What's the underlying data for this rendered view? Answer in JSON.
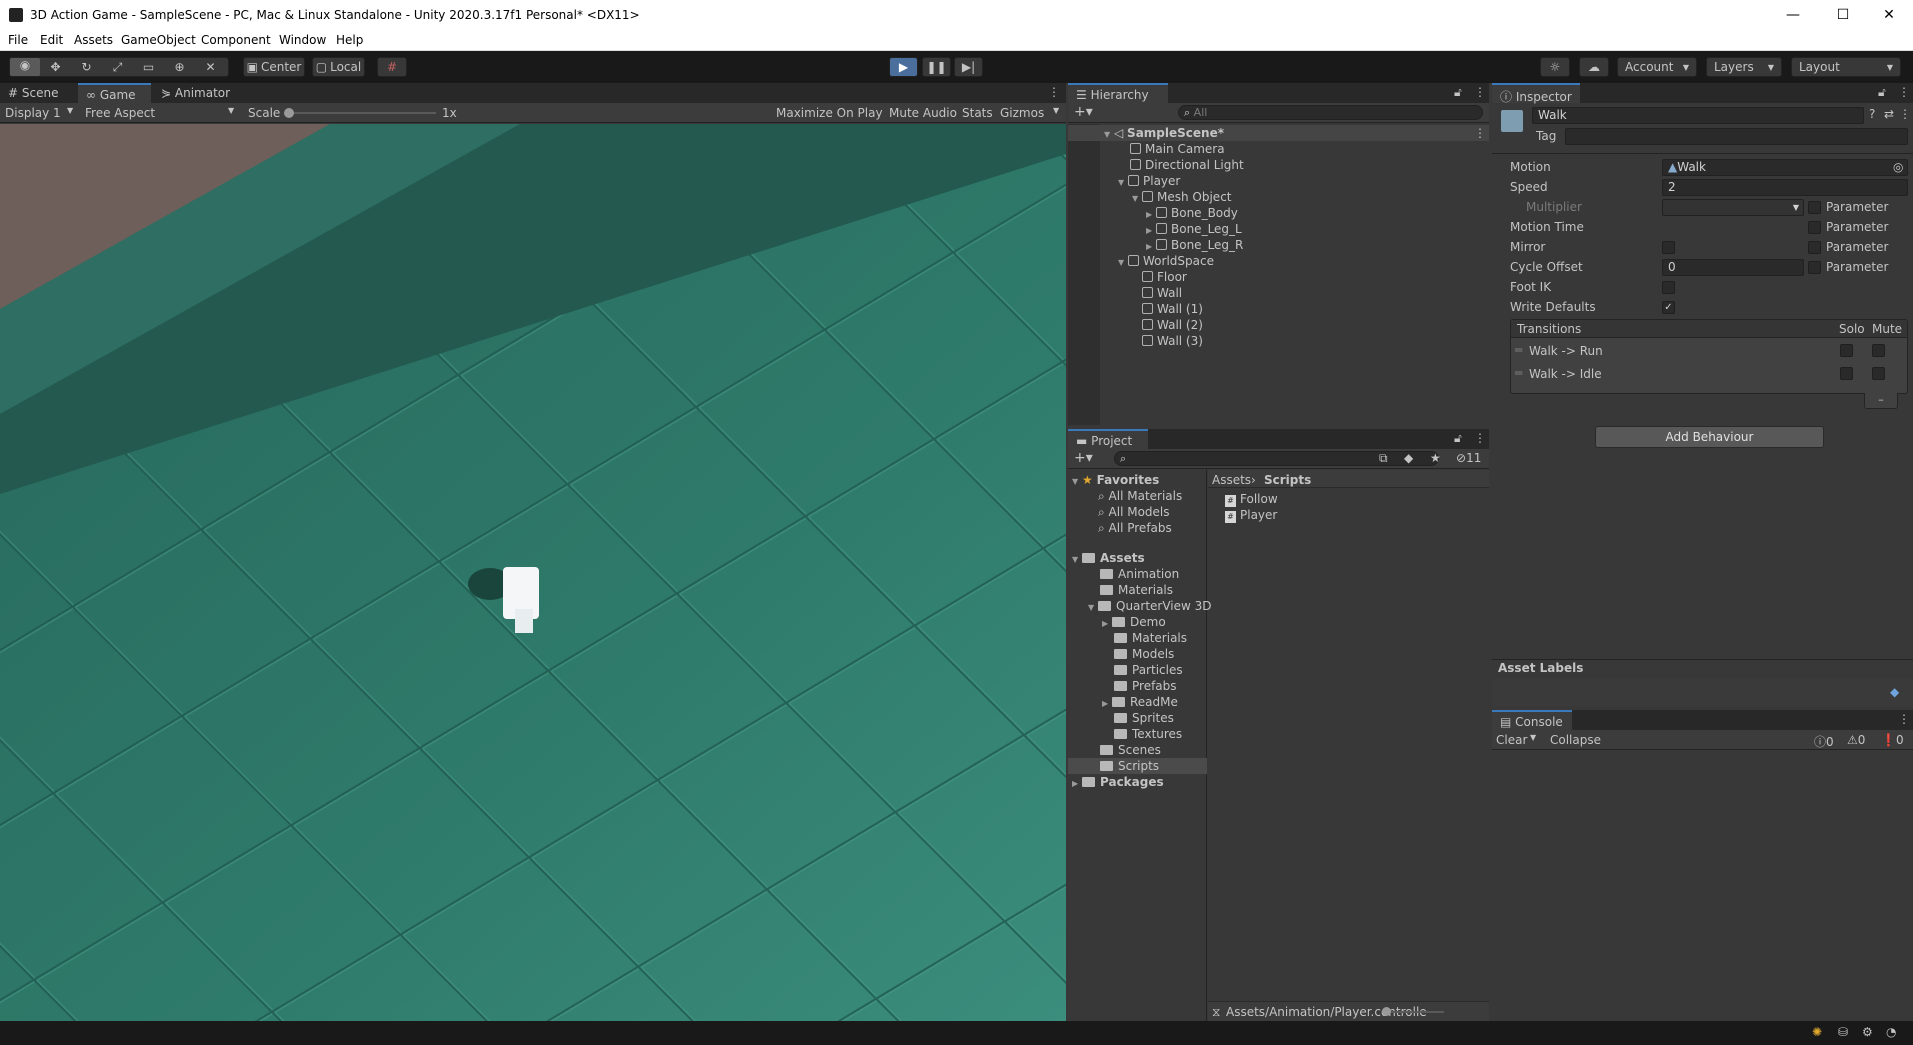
{
  "window": {
    "title": "3D Action Game - SampleScene - PC, Mac & Linux Standalone - Unity 2020.3.17f1 Personal* <DX11>",
    "minimize": "—",
    "maximize": "☐",
    "close": "✕"
  },
  "menu": [
    "File",
    "Edit",
    "Assets",
    "GameObject",
    "Component",
    "Window",
    "Help"
  ],
  "toolbar": {
    "pivot": "Center",
    "space": "Local",
    "account": "Account",
    "layers": "Layers",
    "layout": "Layout"
  },
  "game_view": {
    "tabs": [
      "Scene",
      "Game",
      "Animator"
    ],
    "display": "Display 1",
    "aspect": "Free Aspect",
    "scale_label": "Scale",
    "scale_value": "1x",
    "maximize_on_play": "Maximize On Play",
    "mute_audio": "Mute Audio",
    "stats": "Stats",
    "gizmos": "Gizmos"
  },
  "hierarchy": {
    "tab": "Hierarchy",
    "search_placeholder": "All",
    "scene": "SampleScene*",
    "items": [
      "Main Camera",
      "Directional Light",
      "Player",
      "Mesh Object",
      "Bone_Body",
      "Bone_Leg_L",
      "Bone_Leg_R",
      "WorldSpace",
      "Floor",
      "Wall",
      "Wall (1)",
      "Wall (2)",
      "Wall (3)"
    ]
  },
  "project": {
    "tab": "Project",
    "hidden_count": "11",
    "favorites_label": "Favorites",
    "favorites": [
      "All Materials",
      "All Models",
      "All Prefabs"
    ],
    "assets_label": "Assets",
    "assets_tree": [
      "Animation",
      "Materials",
      "QuarterView 3D",
      "Demo",
      "Materials",
      "Models",
      "Particles",
      "Prefabs",
      "ReadMe",
      "Sprites",
      "Textures",
      "Scenes",
      "Scripts"
    ],
    "packages_label": "Packages",
    "breadcrumb": [
      "Assets",
      "Scripts"
    ],
    "files": [
      "Follow",
      "Player"
    ],
    "status_path": "Assets/Animation/Player.controlle"
  },
  "inspector": {
    "tab": "Inspector",
    "name": "Walk",
    "tag_label": "Tag",
    "motion_label": "Motion",
    "motion_value": "Walk",
    "speed_label": "Speed",
    "speed_value": "2",
    "multiplier_label": "Multiplier",
    "parameter_label": "Parameter",
    "motion_time_label": "Motion Time",
    "mirror_label": "Mirror",
    "cycle_offset_label": "Cycle Offset",
    "cycle_offset_value": "0",
    "foot_ik_label": "Foot IK",
    "write_defaults_label": "Write Defaults",
    "transitions_label": "Transitions",
    "solo_label": "Solo",
    "mute_label": "Mute",
    "transitions": [
      "Walk -> Run",
      "Walk -> Idle"
    ],
    "remove_btn": "–",
    "add_behaviour": "Add Behaviour",
    "asset_labels": "Asset Labels"
  },
  "console": {
    "tab": "Console",
    "clear": "Clear",
    "collapse": "Collapse",
    "log_count": "0",
    "warn_count": "0",
    "error_count": "0"
  },
  "colors": {
    "accent": "#3a79bb",
    "floor": "#2e7b6b",
    "background": "#383838"
  }
}
